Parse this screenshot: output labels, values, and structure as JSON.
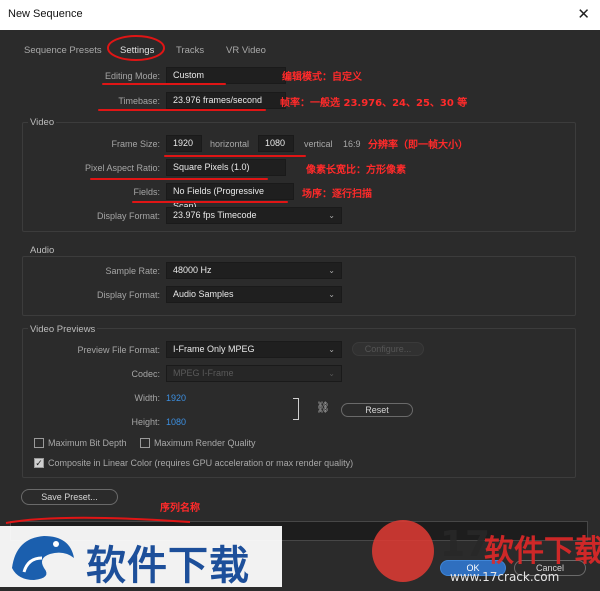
{
  "window": {
    "title": "New Sequence",
    "close_icon": "close-icon"
  },
  "tabs": [
    {
      "label": "Sequence Presets"
    },
    {
      "label": "Settings"
    },
    {
      "label": "Tracks"
    },
    {
      "label": "VR Video"
    }
  ],
  "settings": {
    "editing_mode_label": "Editing Mode:",
    "editing_mode_value": "Custom",
    "timebase_label": "Timebase:",
    "timebase_value": "23.976  frames/second"
  },
  "video": {
    "title": "Video",
    "frame_size_label": "Frame Size:",
    "width": "1920",
    "horizontal_label": "horizontal",
    "height": "1080",
    "vertical_label": "vertical",
    "ratio": "16:9",
    "par_label": "Pixel Aspect Ratio:",
    "par_value": "Square Pixels (1.0)",
    "fields_label": "Fields:",
    "fields_value": "No Fields (Progressive Scan)",
    "display_format_label": "Display Format:",
    "display_format_value": "23.976 fps Timecode"
  },
  "audio": {
    "title": "Audio",
    "sample_rate_label": "Sample Rate:",
    "sample_rate_value": "48000 Hz",
    "display_format_label": "Display Format:",
    "display_format_value": "Audio Samples"
  },
  "previews": {
    "title": "Video Previews",
    "file_format_label": "Preview File Format:",
    "file_format_value": "I-Frame Only MPEG",
    "configure_label": "Configure...",
    "codec_label": "Codec:",
    "codec_value": "MPEG I-Frame",
    "width_label": "Width:",
    "width_value": "1920",
    "height_label": "Height:",
    "height_value": "1080",
    "reset_label": "Reset",
    "max_bit_depth": "Maximum Bit Depth",
    "max_render_quality": "Maximum Render Quality",
    "linear_color": "Composite in Linear Color (requires GPU acceleration or max render quality)"
  },
  "save_preset_label": "Save Preset...",
  "annotations": {
    "editing_mode": "编辑模式：自定义",
    "timebase": "帧率：一般选 23.976、24、25、30 等",
    "frame_size": "分辨率（即一帧大小）",
    "par": "像素长宽比：方形像素",
    "fields": "场序：逐行扫描",
    "sequence_name": "序列名称"
  },
  "footer": {
    "ok_label": "OK",
    "cancel_label": "Cancel"
  },
  "watermarks": {
    "left_text": "软件下载",
    "right_number": "17",
    "right_text": "软件下载",
    "url": "www.17crack.com"
  }
}
